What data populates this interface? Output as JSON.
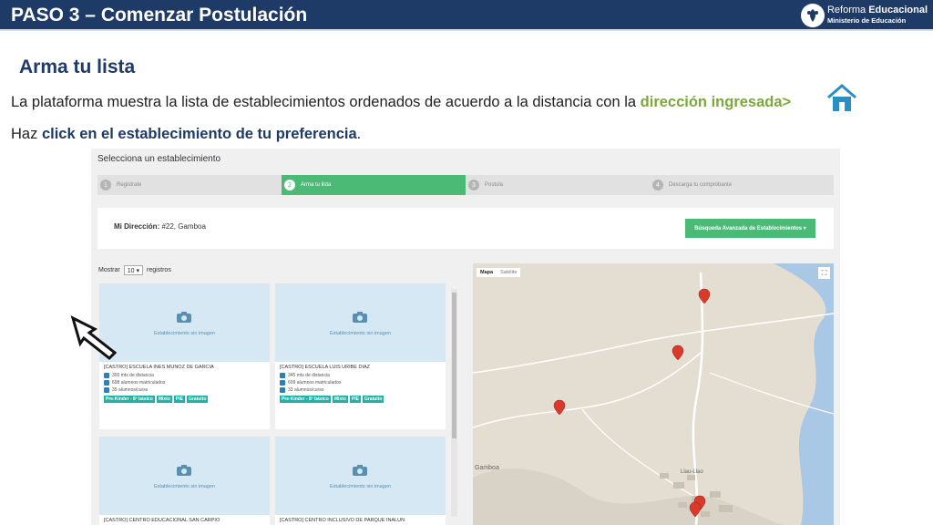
{
  "header": {
    "title": "PASO 3 – Comenzar Postulación",
    "logo_line1_a": "Reforma ",
    "logo_line1_b": "Educacional",
    "logo_line2": "Ministerio de Educación"
  },
  "subtitle": "Arma tu lista",
  "text1": {
    "before": "La plataforma muestra la lista de establecimientos ordenados de acuerdo a la distancia con la ",
    "highlight": "dirección ingresada>"
  },
  "text2": {
    "before": "Haz ",
    "bold": "click en el establecimiento de tu preferencia",
    "after": "."
  },
  "screenshot": {
    "heading": "Selecciona un establecimiento",
    "steps": [
      {
        "num": "1",
        "label": "Registrate"
      },
      {
        "num": "2",
        "label": "Arma tu lista"
      },
      {
        "num": "3",
        "label": "Postula"
      },
      {
        "num": "4",
        "label": "Descarga tu comprobante"
      }
    ],
    "address_label": "Mi Dirección:",
    "address_value": " #22, Gamboa",
    "advanced_button": "Búsqueda Avanzada de Establecimientos ▾",
    "show_prefix": "Mostrar",
    "show_value": "10 ▾",
    "show_suffix": "registros",
    "no_image_label": "Establecimiento sin imagen",
    "cards": [
      {
        "name": "[CASTRO] ESCUELA INES MUNOZ DE GARCIA",
        "distance": "300 mts de distancia",
        "enrolled": "698 alumnos matriculados",
        "per_course": "35 alumnos/curso",
        "tags": [
          "Pre-Kínder - 8º básico",
          "Mixto",
          "PIE",
          "Gratuito"
        ]
      },
      {
        "name": "[CASTRO] ESCUELA LUIS URIBE DIAZ",
        "distance": "345 mts de distancia",
        "enrolled": "609 alumnos matriculados",
        "per_course": "33 alumnos/curso",
        "tags": [
          "Pre-Kínder - 8º básico",
          "Mixto",
          "PIE",
          "Gratuito"
        ]
      },
      {
        "name": "[CASTRO] CENTRO EDUCACIONAL SAN CARPIO"
      },
      {
        "name": "[CASTRO] CENTRO INCLUSIVO DE PARQUE INALUN"
      }
    ],
    "map": {
      "tab_map": "Mapa",
      "tab_satellite": "Satélite",
      "place_label": "Gamboa",
      "town_label": "Llau-Llao"
    }
  }
}
